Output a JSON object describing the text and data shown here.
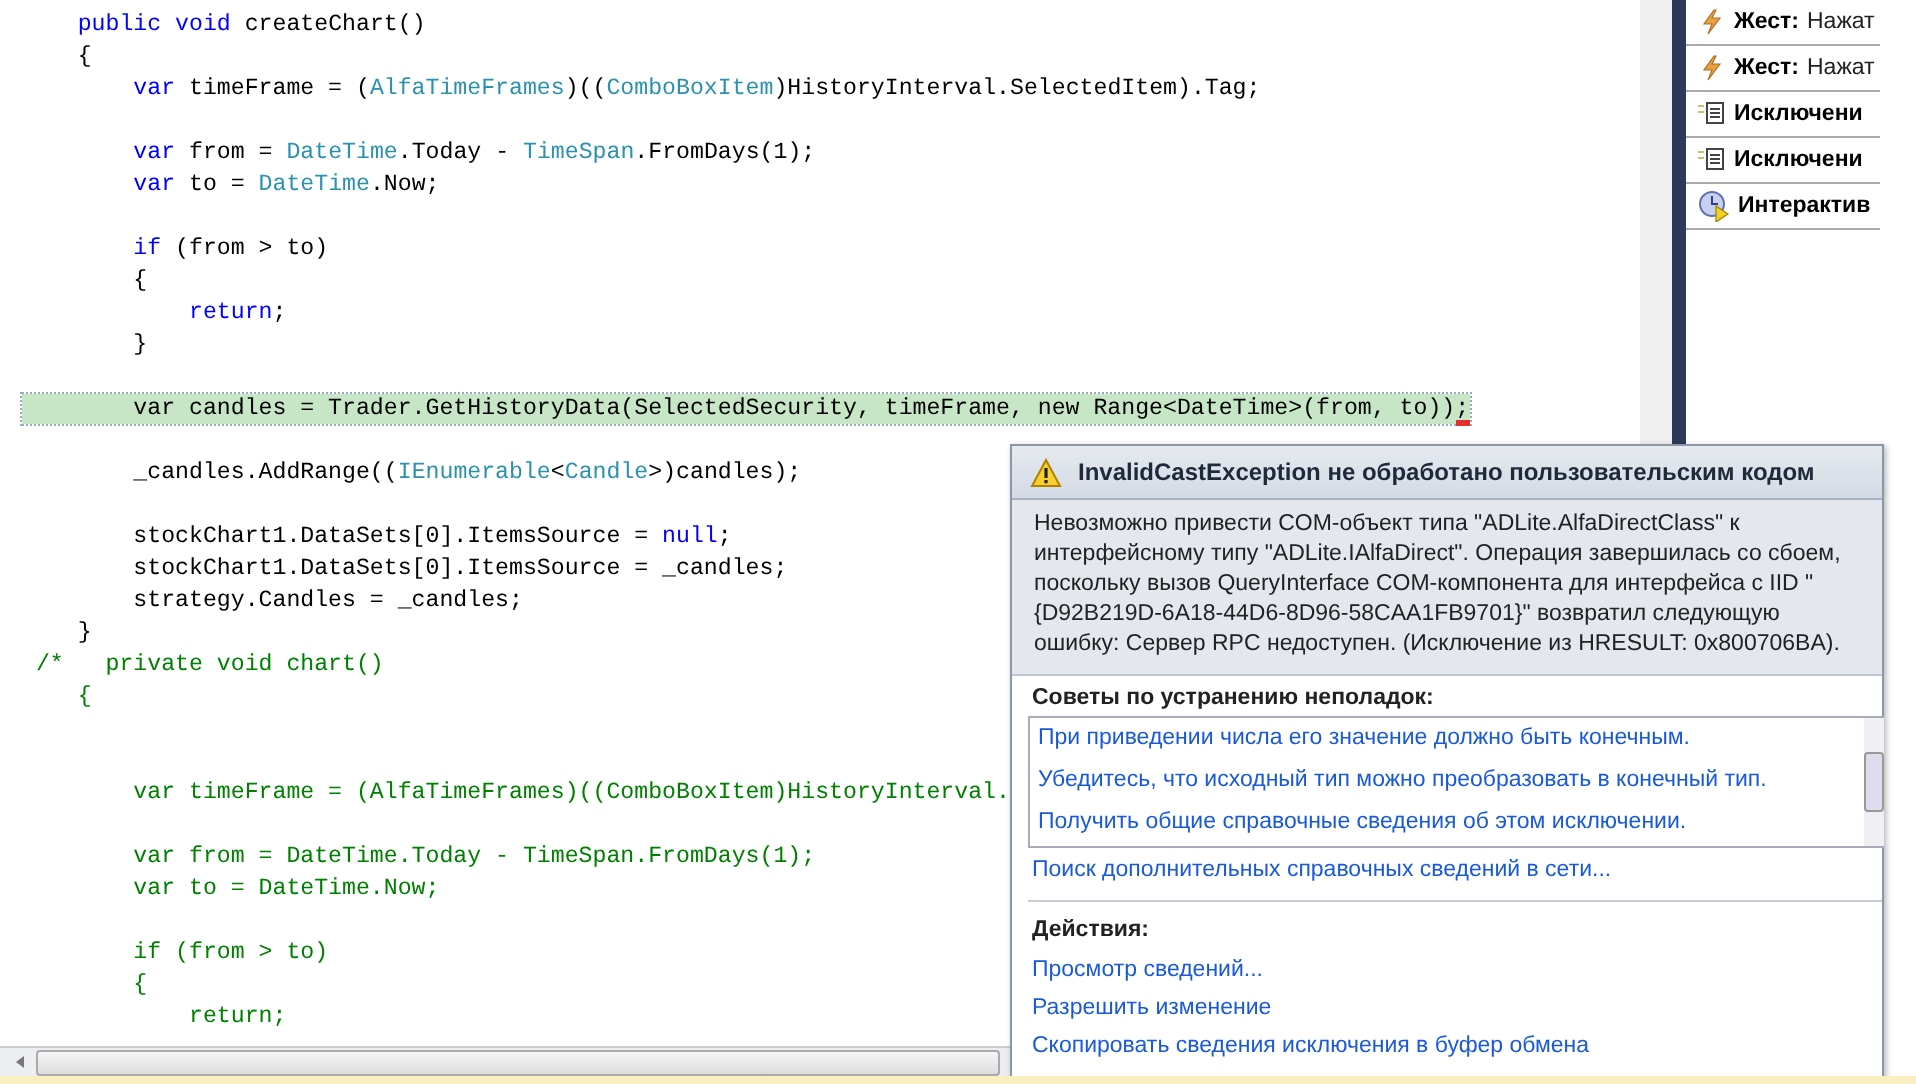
{
  "code": {
    "lines": [
      {
        "kind": "normal",
        "tokens": [
          {
            "text": "    public void",
            "kind": "kw"
          },
          {
            "text": " createChart()",
            "kind": "plain"
          }
        ]
      },
      {
        "kind": "normal",
        "tokens": [
          {
            "text": "    {",
            "kind": "plain"
          }
        ]
      },
      {
        "kind": "normal",
        "tokens": [
          {
            "text": "        var",
            "kind": "kw"
          },
          {
            "text": " timeFrame = (",
            "kind": "plain"
          },
          {
            "text": "AlfaTimeFrames",
            "kind": "type"
          },
          {
            "text": ")((",
            "kind": "plain"
          },
          {
            "text": "ComboBoxItem",
            "kind": "type"
          },
          {
            "text": ")HistoryInterval.SelectedItem).Tag;",
            "kind": "plain"
          }
        ]
      },
      {
        "kind": "blank"
      },
      {
        "kind": "normal",
        "tokens": [
          {
            "text": "        var",
            "kind": "kw"
          },
          {
            "text": " from = ",
            "kind": "plain"
          },
          {
            "text": "DateTime",
            "kind": "type"
          },
          {
            "text": ".Today - ",
            "kind": "plain"
          },
          {
            "text": "TimeSpan",
            "kind": "type"
          },
          {
            "text": ".FromDays(1);",
            "kind": "plain"
          }
        ]
      },
      {
        "kind": "normal",
        "tokens": [
          {
            "text": "        var",
            "kind": "kw"
          },
          {
            "text": " to = ",
            "kind": "plain"
          },
          {
            "text": "DateTime",
            "kind": "type"
          },
          {
            "text": ".Now;",
            "kind": "plain"
          }
        ]
      },
      {
        "kind": "blank"
      },
      {
        "kind": "normal",
        "tokens": [
          {
            "text": "        if",
            "kind": "kw"
          },
          {
            "text": " (from > to)",
            "kind": "plain"
          }
        ]
      },
      {
        "kind": "normal",
        "tokens": [
          {
            "text": "        {",
            "kind": "plain"
          }
        ]
      },
      {
        "kind": "normal",
        "tokens": [
          {
            "text": "            return",
            "kind": "kw"
          },
          {
            "text": ";",
            "kind": "plain"
          }
        ]
      },
      {
        "kind": "normal",
        "tokens": [
          {
            "text": "        }",
            "kind": "plain"
          }
        ]
      },
      {
        "kind": "blank"
      },
      {
        "kind": "current",
        "tokens": [
          {
            "text": "        var candles = Trader.GetHistoryData(SelectedSecurity, timeFrame, new Range<DateTime>(from, to));",
            "kind": "plain"
          }
        ]
      },
      {
        "kind": "blank"
      },
      {
        "kind": "normal",
        "tokens": [
          {
            "text": "        _candles.AddRange((",
            "kind": "plain"
          },
          {
            "text": "IEnumerable",
            "kind": "type"
          },
          {
            "text": "<",
            "kind": "plain"
          },
          {
            "text": "Candle",
            "kind": "type"
          },
          {
            "text": ">)candles);",
            "kind": "plain"
          }
        ]
      },
      {
        "kind": "blank"
      },
      {
        "kind": "normal",
        "tokens": [
          {
            "text": "        stockChart1.DataSets[0].ItemsSource = ",
            "kind": "plain"
          },
          {
            "text": "null",
            "kind": "kw"
          },
          {
            "text": ";",
            "kind": "plain"
          }
        ]
      },
      {
        "kind": "normal",
        "tokens": [
          {
            "text": "        stockChart1.DataSets[0].ItemsSource = _candles;",
            "kind": "plain"
          }
        ]
      },
      {
        "kind": "normal",
        "tokens": [
          {
            "text": "        strategy.Candles = _candles;",
            "kind": "plain"
          }
        ]
      },
      {
        "kind": "normal",
        "tokens": [
          {
            "text": "    }",
            "kind": "plain"
          }
        ]
      },
      {
        "kind": "normal",
        "tokens": [
          {
            "text": " /*   private void chart()",
            "kind": "comment"
          }
        ]
      },
      {
        "kind": "normal",
        "tokens": [
          {
            "text": "    {",
            "kind": "comment"
          }
        ]
      },
      {
        "kind": "blank"
      },
      {
        "kind": "blank"
      },
      {
        "kind": "normal",
        "tokens": [
          {
            "text": "        var timeFrame = (AlfaTimeFrames)((ComboBoxItem)HistoryInterval.",
            "kind": "comment"
          }
        ]
      },
      {
        "kind": "blank"
      },
      {
        "kind": "normal",
        "tokens": [
          {
            "text": "        var from = DateTime.Today - TimeSpan.FromDays(1);",
            "kind": "comment"
          }
        ]
      },
      {
        "kind": "normal",
        "tokens": [
          {
            "text": "        var to = DateTime.Now;",
            "kind": "comment"
          }
        ]
      },
      {
        "kind": "blank"
      },
      {
        "kind": "normal",
        "tokens": [
          {
            "text": "        if (from > to)",
            "kind": "comment"
          }
        ]
      },
      {
        "kind": "normal",
        "tokens": [
          {
            "text": "        {",
            "kind": "comment"
          }
        ]
      },
      {
        "kind": "normal",
        "tokens": [
          {
            "text": "            return;",
            "kind": "comment"
          }
        ]
      }
    ]
  },
  "events": [
    {
      "kind": "gesture",
      "label": "Жест:",
      "detail": "Нажат"
    },
    {
      "kind": "gesture",
      "label": "Жест:",
      "detail": "Нажат"
    },
    {
      "kind": "exception",
      "label": "Исключени"
    },
    {
      "kind": "exception",
      "label": "Исключени"
    },
    {
      "kind": "interactive",
      "label": "Интерактив"
    }
  ],
  "exception_popup": {
    "title": "InvalidCastException не обработано пользовательским кодом",
    "message": "Невозможно привести COM-объект типа \"ADLite.AlfaDirectClass\" к интерфейсному типу \"ADLite.IAlfaDirect\". Операция завершилась со сбоем, поскольку вызов QueryInterface COM-компонента для интерфейса с IID \"{D92B219D-6A18-44D6-8D96-58CAA1FB9701}\" возвратил следующую ошибку: Сервер RPC недоступен. (Исключение из HRESULT: 0x800706BA).",
    "tips_heading": "Советы по устранению неполадок:",
    "tips": [
      "При приведении числа его значение должно быть конечным.",
      "Убедитесь, что исходный тип можно преобразовать в конечный тип.",
      "Получить общие справочные сведения об этом исключении."
    ],
    "search_link": "Поиск дополнительных справочных сведений в сети...",
    "actions_heading": "Действия:",
    "actions": [
      "Просмотр сведений...",
      "Разрешить изменение",
      "Скопировать сведения исключения в буфер обмена"
    ]
  }
}
